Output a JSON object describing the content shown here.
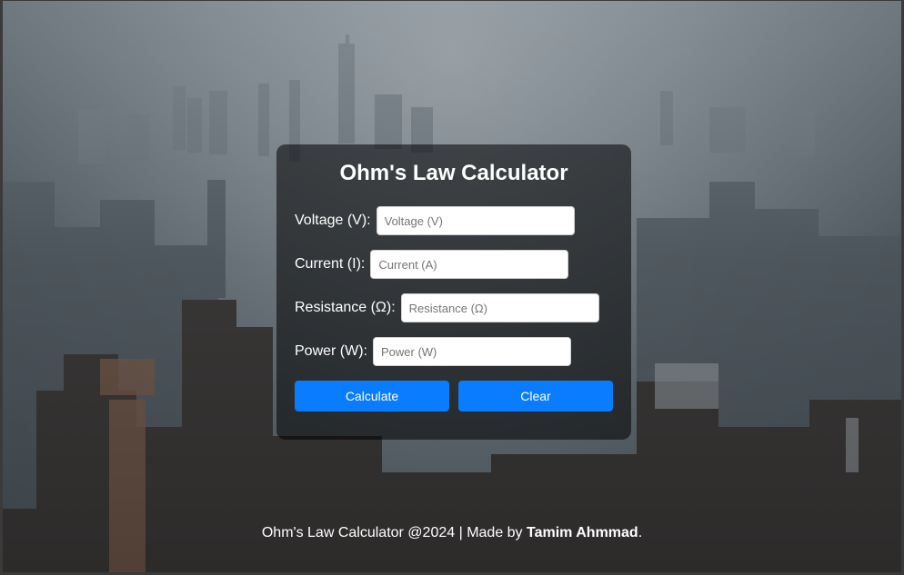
{
  "calculator": {
    "title": "Ohm's Law Calculator",
    "fields": [
      {
        "label": "Voltage (V):",
        "placeholder": "Voltage (V)",
        "value": ""
      },
      {
        "label": "Current (I):",
        "placeholder": "Current (A)",
        "value": ""
      },
      {
        "label": "Resistance (Ω):",
        "placeholder": "Resistance (Ω)",
        "value": ""
      },
      {
        "label": "Power (W):",
        "placeholder": "Power (W)",
        "value": ""
      }
    ],
    "calculate_label": "Calculate",
    "clear_label": "Clear"
  },
  "footer": {
    "text": "Ohm's Law Calculator @2024 | Made by ",
    "author": "Tamim Ahmmad",
    "suffix": "."
  },
  "colors": {
    "accent": "#0a7cff",
    "card_background": "rgba(0,0,0,0.55)"
  }
}
